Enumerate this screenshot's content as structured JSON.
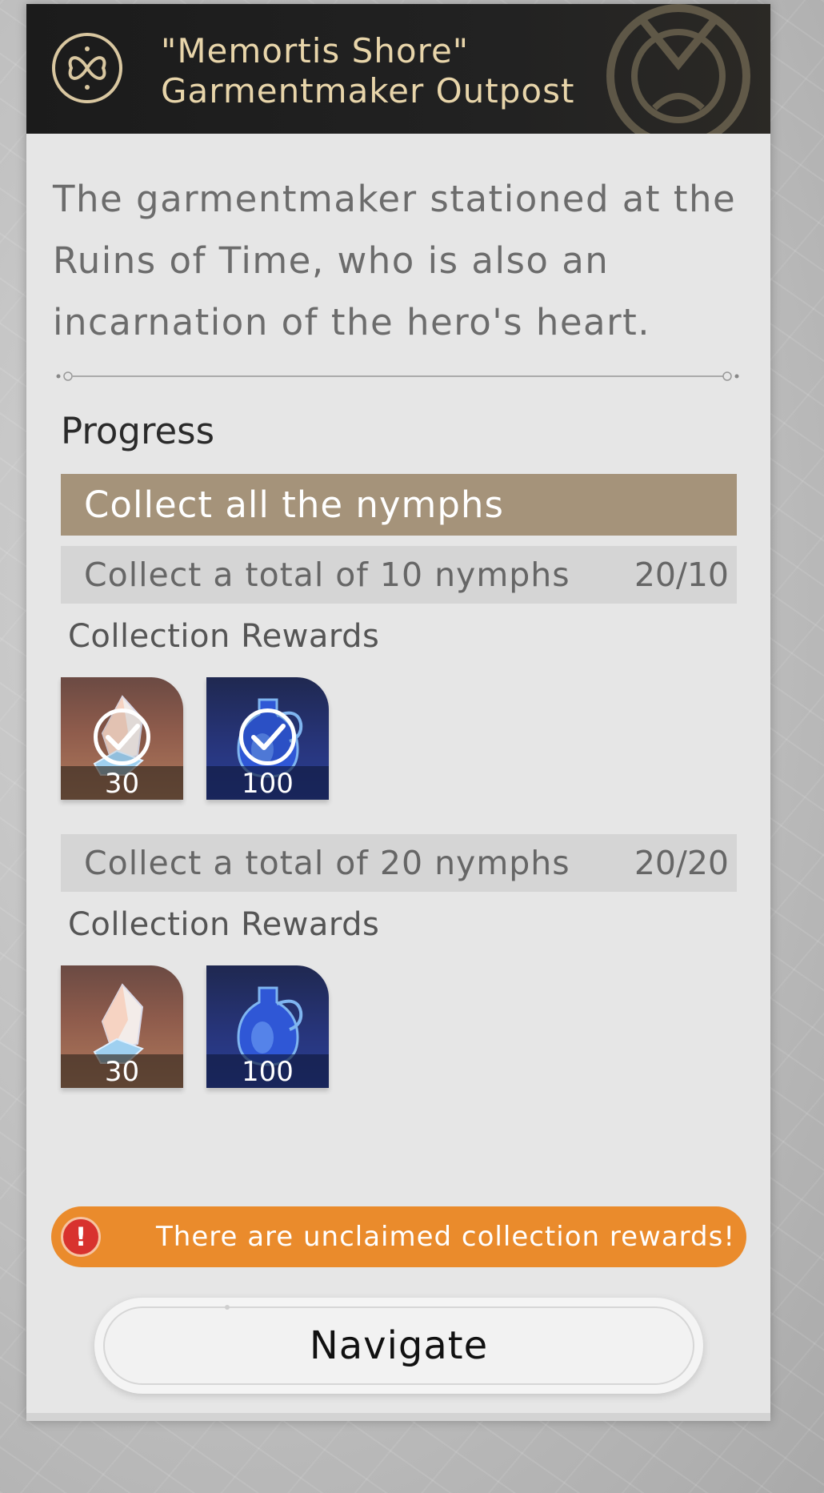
{
  "header": {
    "title_line1": "\"Memortis Shore\"",
    "title_line2": "Garmentmaker Outpost",
    "emblem_icon": "butterfly-emblem-icon",
    "title_color": "#e8d5aa"
  },
  "description": "The garmentmaker stationed at the Ruins of Time, who is also an incarnation of the hero's heart.",
  "progress": {
    "heading": "Progress",
    "objective": "Collect all the nymphs",
    "tasks": [
      {
        "label": "Collect a total of 10 nymphs",
        "count": "20/10",
        "rewards_label": "Collection Rewards",
        "rewards": [
          {
            "icon": "stellar-jade-icon",
            "qty": "30",
            "claimed": true
          },
          {
            "icon": "fuel-bottle-icon",
            "qty": "100",
            "claimed": true
          }
        ]
      },
      {
        "label": "Collect a total of 20 nymphs",
        "count": "20/20",
        "rewards_label": "Collection Rewards",
        "rewards": [
          {
            "icon": "stellar-jade-icon",
            "qty": "30",
            "claimed": false
          },
          {
            "icon": "fuel-bottle-icon",
            "qty": "100",
            "claimed": false
          }
        ]
      }
    ]
  },
  "alert": {
    "icon": "exclamation-icon",
    "text": "There are unclaimed collection rewards!",
    "color": "#ea8b2c"
  },
  "navigate_label": "Navigate",
  "colors": {
    "objective_bg": "#a5937a",
    "header_bg": "#1b1b1b",
    "panel_bg": "#e6e6e6"
  }
}
